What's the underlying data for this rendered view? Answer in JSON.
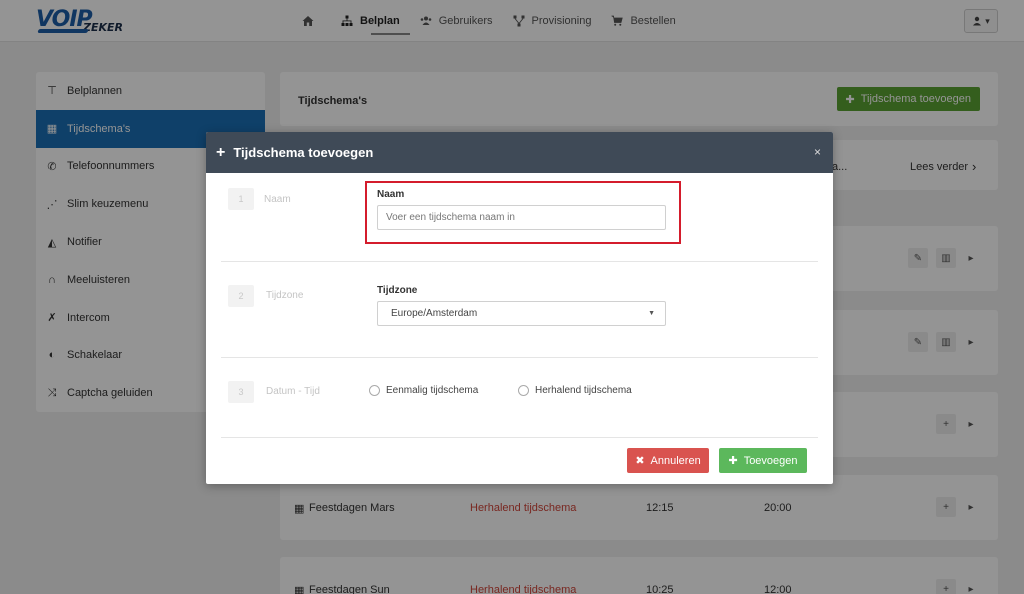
{
  "logo": {
    "part1": "VOIP",
    "part2": "ZEKER"
  },
  "nav": {
    "items": [
      {
        "label": ""
      },
      {
        "label": "Belplan"
      },
      {
        "label": "Gebruikers"
      },
      {
        "label": "Provisioning"
      },
      {
        "label": "Bestellen"
      }
    ],
    "user_caret": "▾"
  },
  "sidebar": {
    "items": [
      {
        "icon": "sitemap-icon",
        "label": "Belplannen"
      },
      {
        "icon": "calendar-icon",
        "label": "Tijdschema's"
      },
      {
        "icon": "phone-icon",
        "label": "Telefoonnummers"
      },
      {
        "icon": "menu-branch-icon",
        "label": "Slim keuzemenu"
      },
      {
        "icon": "notifier-icon",
        "label": "Notifier"
      },
      {
        "icon": "headphones-icon",
        "label": "Meeluisteren"
      },
      {
        "icon": "intercom-icon",
        "label": "Intercom"
      },
      {
        "icon": "toggle-icon",
        "label": "Schakelaar"
      },
      {
        "icon": "shuffle-icon",
        "label": "Captcha geluiden"
      }
    ]
  },
  "main": {
    "header_title": "Tijdschema's",
    "add_button": "Tijdschema toevoegen",
    "info_ellipsis": "a...",
    "read_more": "Lees verder",
    "rows": [
      {
        "name": "Feestdagen Mars",
        "type": "Herhalend tijdschema",
        "start": "12:15",
        "end": "20:00"
      },
      {
        "name": "Feestdagen Sun",
        "type": "Herhalend tijdschema",
        "start": "10:25",
        "end": "12:00"
      }
    ]
  },
  "modal": {
    "title": "Tijdschema toevoegen",
    "close": "×",
    "steps": [
      {
        "number": "1",
        "label": "Naam"
      },
      {
        "number": "2",
        "label": "Tijdzone"
      },
      {
        "number": "3",
        "label": "Datum - Tijd"
      }
    ],
    "name_label": "Naam",
    "name_placeholder": "Voer een tijdschema naam in",
    "timezone_label": "Tijdzone",
    "timezone_value": "Europe/Amsterdam",
    "radio_once": "Eenmalig tijdschema",
    "radio_repeat": "Herhalend tijdschema",
    "cancel_button": "Annuleren",
    "submit_button": "Toevoegen"
  },
  "colors": {
    "primary": "#1b6fb5",
    "modal_header": "#3f4a57",
    "cancel": "#d9534f",
    "submit": "#5cb85c",
    "add_green": "#5ba332",
    "highlight": "#d41c2c"
  }
}
